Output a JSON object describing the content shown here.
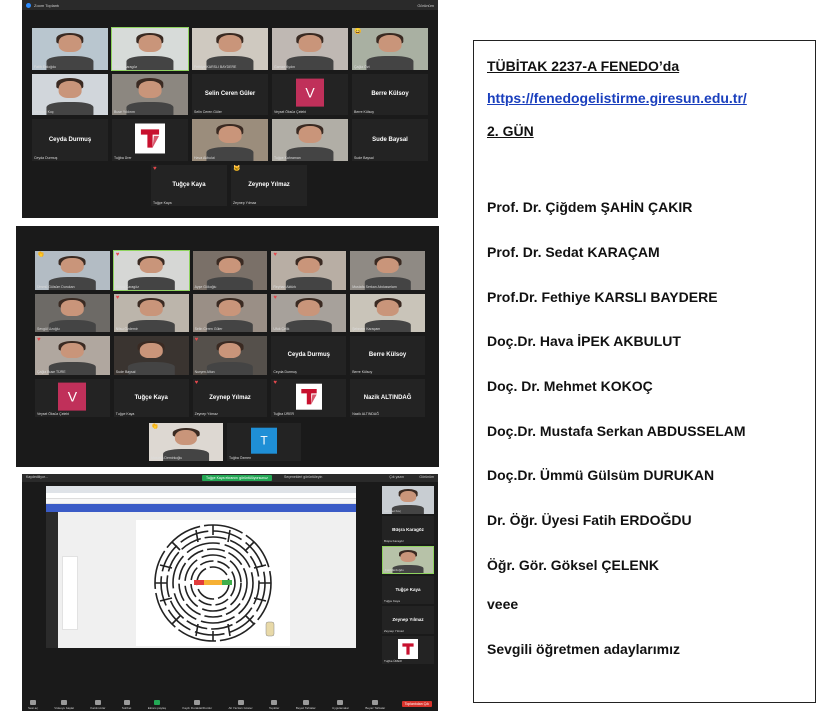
{
  "window1": {
    "title": "Zoom Toplantı",
    "top_right": "Görünüm",
    "tiles": [
      {
        "name": "Fatih Erdoğdu",
        "kind": "video",
        "bg": "#b9c6cf"
      },
      {
        "name": "Büşra Karagöz",
        "kind": "video",
        "bg": "#d7dbd9",
        "active": true
      },
      {
        "name": "Fethiye KARSLI BAYDERE",
        "kind": "video",
        "bg": "#cfc9c0"
      },
      {
        "name": "Gamze Aydın",
        "kind": "video",
        "bg": "#bfb8b3"
      },
      {
        "name": "Çağla Özt",
        "kind": "video",
        "bg": "#a9b0a2",
        "react": "😄"
      },
      {
        "name": "Mehmet Koç",
        "kind": "video",
        "bg": "#d1d6db"
      },
      {
        "name": "Buse Yıldırım",
        "kind": "video",
        "bg": "#8c8780"
      },
      {
        "name": "Selin Ceren Güler",
        "kind": "text",
        "label": "Selin Ceren Güler"
      },
      {
        "name": "Veysel Öksüz Çelebi",
        "kind": "avatar-v",
        "label": "V"
      },
      {
        "name": "Berre Külsoy",
        "kind": "text",
        "label": "Berre Külsoy"
      },
      {
        "name": "Ceyda Durmuş",
        "kind": "text",
        "label": "Ceyda Durmuş"
      },
      {
        "name": "Tuğba Ürer",
        "kind": "logo"
      },
      {
        "name": "Hava Akbulut",
        "kind": "video",
        "bg": "#9b8d7c"
      },
      {
        "name": "Tuğçe Kahraman",
        "kind": "video",
        "bg": "#b1aea6"
      },
      {
        "name": "Sude Baysal",
        "kind": "text",
        "label": "Sude Baysal"
      },
      {
        "name": "Tuğçe Kaya",
        "kind": "text",
        "label": "Tuğçe Kaya",
        "heart": true
      },
      {
        "name": "Zeynep Yılmaz",
        "kind": "text",
        "label": "Zeynep Yılmaz",
        "react": "🐱"
      }
    ]
  },
  "window2": {
    "tiles": [
      {
        "name": "Ümmü Gülsüm Durukan",
        "kind": "video",
        "bg": "#b3bcc4",
        "react": "👏"
      },
      {
        "name": "Büşra Karagöz",
        "kind": "video",
        "bg": "#d6d7d5",
        "heart": true,
        "active": true
      },
      {
        "name": "Ayşe Gökoğlu",
        "kind": "video",
        "bg": "#7a7068"
      },
      {
        "name": "Reyhan Aktürk",
        "kind": "video",
        "bg": "#b8aea4",
        "heart": true
      },
      {
        "name": "Mustafa Serkan Abdusselam",
        "kind": "video",
        "bg": "#8f8a84"
      },
      {
        "name": "Sevgül Uzoğlu",
        "kind": "video",
        "bg": "#6d6a66"
      },
      {
        "name": "Nilsu Özdemir",
        "kind": "video",
        "bg": "#bcb5ab",
        "heart": true
      },
      {
        "name": "Selin Ceren Güler",
        "kind": "video",
        "bg": "#9a8f86"
      },
      {
        "name": "Ufuk Çelik",
        "kind": "video",
        "bg": "#a7a19b",
        "heart": true
      },
      {
        "name": "Şebnem Karaçam",
        "kind": "video",
        "bg": "#c9c4b9"
      },
      {
        "name": "Çağla Buse TÜRE",
        "kind": "video",
        "bg": "#b0a79f",
        "heart": true
      },
      {
        "name": "Sude Baysal",
        "kind": "video",
        "bg": "#3a3430"
      },
      {
        "name": "Nurşen Altun",
        "kind": "video",
        "bg": "#55504b",
        "heart": true
      },
      {
        "name": "Ceyda Durmuş",
        "kind": "text",
        "label": "Ceyda Durmuş"
      },
      {
        "name": "Berre Külsoy",
        "kind": "text",
        "label": "Berre Külsoy"
      },
      {
        "name": "Veysel Öksüz Çelebi",
        "kind": "avatar-v",
        "label": "V"
      },
      {
        "name": "Tuğçe Kaya",
        "kind": "text",
        "label": "Tuğçe Kaya"
      },
      {
        "name": "Zeynep Yılmaz",
        "kind": "text",
        "label": "Zeynep Yılmaz",
        "heart": true
      },
      {
        "name": "Tuğba ÜRER",
        "kind": "logo",
        "heart": true
      },
      {
        "name": "Nazik ALTINDAĞ",
        "kind": "text",
        "label": "Nazik ALTINDAĞ"
      }
    ],
    "bottom_tiles": [
      {
        "name": "Mustafa Demirkoğlu",
        "kind": "video",
        "bg": "#ddd8d2",
        "react": "👏"
      },
      {
        "name": "Tuğba Özmen",
        "kind": "avatar-t",
        "label": "T"
      }
    ]
  },
  "window3": {
    "title": "Kaydediliyor...",
    "top_right_1": "Çık yazın",
    "top_right_2": "Görünüm",
    "green_bar": "Tuğçe Kaya ekranını görüntülüyorsunuz",
    "options_label": "Seçenekleri görüntüleyin",
    "right_tiles": [
      {
        "name": "Mehmet Koç",
        "kind": "video"
      },
      {
        "name": "Büşra Karagöz",
        "kind": "text",
        "label": "Büşra Karagöz"
      },
      {
        "name": "Fatih Erdoğdu",
        "kind": "video",
        "active": true
      },
      {
        "name": "Tuğçe Kaya",
        "kind": "text",
        "label": "Tuğçe Kaya"
      },
      {
        "name": "Zeynep Yılmaz",
        "kind": "text",
        "label": "Zeynep Yılmaz"
      },
      {
        "name": "Tuğba ÜRER",
        "kind": "logo"
      }
    ],
    "toolbar": [
      {
        "label": "Sesi aç"
      },
      {
        "label": "Videoyu başlat"
      },
      {
        "label": "Katılımcılar"
      },
      {
        "label": "Sohbet"
      },
      {
        "label": "Ekranı paylaş",
        "green": true
      },
      {
        "label": "Kaydı Duraklat/Durdur"
      },
      {
        "label": "Alt Yazıları Göster"
      },
      {
        "label": "Tepkiler"
      },
      {
        "label": "Beyaz Tahtalar"
      },
      {
        "label": "Uygulamalar"
      },
      {
        "label": "Beyaz Tahtalar"
      }
    ],
    "end_label": "Toplantıdan Çık"
  },
  "info": {
    "heading": "TÜBİTAK 2237-A FENEDO’da",
    "link": "https://fenedogelistirme.giresun.edu.tr/",
    "day": "2. GÜN",
    "names": [
      "Prof. Dr. Çiğdem ŞAHİN ÇAKIR",
      "Prof. Dr. Sedat KARAÇAM",
      "Prof.Dr. Fethiye KARSLI BAYDERE",
      "Doç.Dr. Hava İPEK AKBULUT",
      "Doç. Dr. Mehmet KOKOÇ",
      "Doç.Dr. Mustafa Serkan ABDUSSELAM",
      "Doç.Dr. Ümmü Gülsüm DURUKAN",
      "Dr. Öğr. Üyesi Fatih ERDOĞDU",
      "Öğr. Gör. Göksel ÇELENK",
      "veee",
      "Sevgili öğretmen adaylarımız"
    ]
  }
}
